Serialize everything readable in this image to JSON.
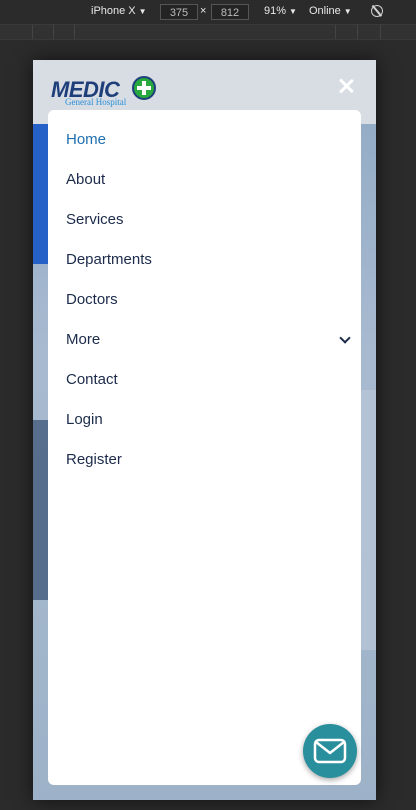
{
  "devtools": {
    "device": "iPhone X",
    "width": "375",
    "height": "812",
    "times": "×",
    "zoom": "91%",
    "network": "Online"
  },
  "site": {
    "logo_text": "MEDIC",
    "logo_subtitle": "General Hospital"
  },
  "menu": {
    "items": [
      {
        "label": "Home",
        "active": true
      },
      {
        "label": "About"
      },
      {
        "label": "Services"
      },
      {
        "label": "Departments"
      },
      {
        "label": "Doctors"
      },
      {
        "label": "More",
        "has_submenu": true
      },
      {
        "label": "Contact"
      },
      {
        "label": "Login"
      },
      {
        "label": "Register"
      }
    ]
  },
  "colors": {
    "accent": "#1f6fb0",
    "text": "#1c2b4a",
    "mail_button": "#2a8f9c"
  },
  "icons": {
    "close": "close-icon",
    "chevron": "chevron-down-icon",
    "mail": "mail-icon",
    "rotate": "rotate-icon"
  }
}
